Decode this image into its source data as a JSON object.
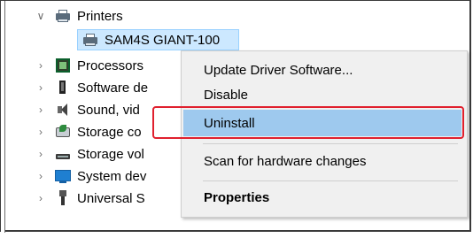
{
  "tree": {
    "printers_label": "Printers",
    "device_label": "SAM4S GIANT-100",
    "items": [
      {
        "label": "Processors"
      },
      {
        "label": "Software de"
      },
      {
        "label": "Sound, vid"
      },
      {
        "label": "Storage co"
      },
      {
        "label": "Storage vol"
      },
      {
        "label": "System dev"
      },
      {
        "label": "Universal S"
      }
    ]
  },
  "icons": {
    "expand": "chevron-down",
    "collapse": "chevron-right",
    "printer": "printer-icon",
    "processor": "processor-icon",
    "software": "software-device-icon",
    "sound": "speaker-icon",
    "storage_controller": "storage-controller-icon",
    "storage_volume": "storage-volume-icon",
    "system": "monitor-icon",
    "usb": "usb-icon"
  },
  "context_menu": {
    "update": "Update Driver Software...",
    "disable": "Disable",
    "uninstall": "Uninstall",
    "scan": "Scan for hardware changes",
    "properties": "Properties"
  },
  "colors": {
    "highlight": "#9ec9ee",
    "selection": "#cce8ff",
    "annotation_red": "#e0202e"
  }
}
